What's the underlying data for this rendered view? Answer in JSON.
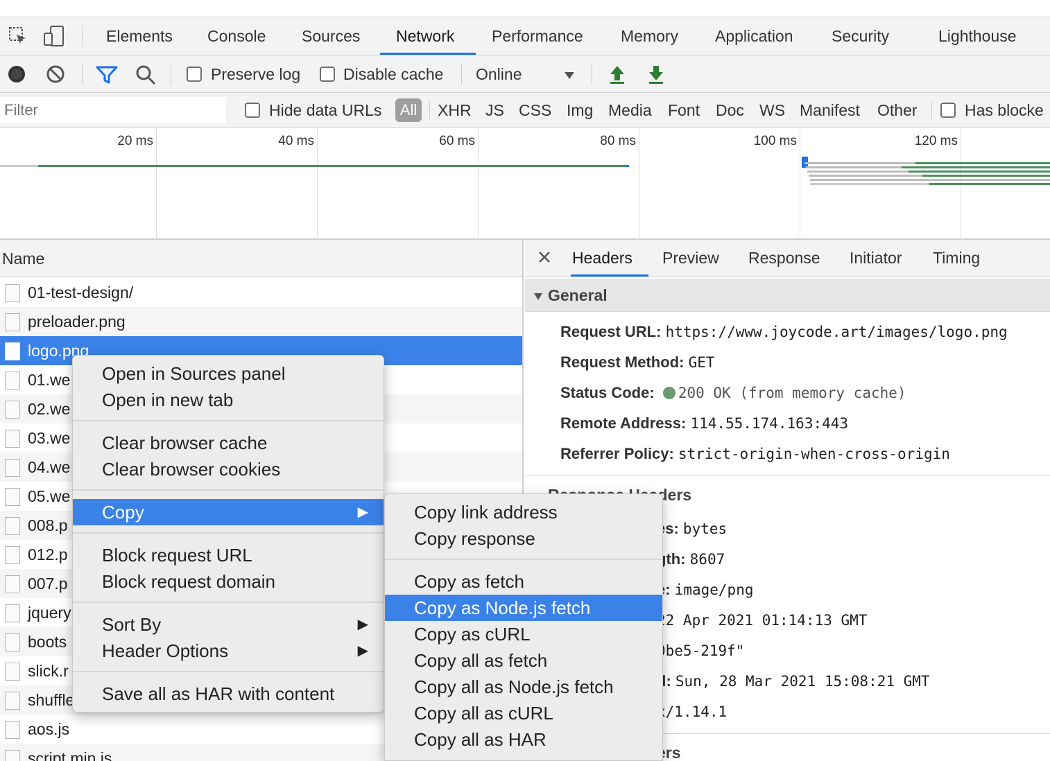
{
  "tabs": [
    {
      "label": "Elements"
    },
    {
      "label": "Console"
    },
    {
      "label": "Sources"
    },
    {
      "label": "Network",
      "active": true
    },
    {
      "label": "Performance"
    },
    {
      "label": "Memory"
    },
    {
      "label": "Application"
    },
    {
      "label": "Security"
    },
    {
      "label": "Lighthouse"
    }
  ],
  "toolbar": {
    "preserve_log": "Preserve log",
    "disable_cache": "Disable cache",
    "throttle": "Online",
    "icons": [
      "record-icon",
      "clear-icon",
      "filter-icon",
      "search-icon",
      "import-icon",
      "export-icon"
    ]
  },
  "filter": {
    "placeholder": "Filter",
    "hide_data_urls": "Hide data URLs",
    "types": [
      "All",
      "XHR",
      "JS",
      "CSS",
      "Img",
      "Media",
      "Font",
      "Doc",
      "WS",
      "Manifest",
      "Other"
    ],
    "has_blocked": "Has blocke"
  },
  "timeline": {
    "ticks": [
      "20 ms",
      "40 ms",
      "60 ms",
      "80 ms",
      "100 ms",
      "120 ms"
    ]
  },
  "list": {
    "header": "Name",
    "rows": [
      "01-test-design/",
      "preloader.png",
      "logo.png",
      "01.we",
      "02.we",
      "03.we",
      "04.we",
      "05.we",
      "008.p",
      "012.p",
      "007.p",
      "jquery",
      "boots",
      "slick.r",
      "shuffle",
      "aos.js",
      "script.min.js"
    ]
  },
  "detail": {
    "tabs": [
      "Headers",
      "Preview",
      "Response",
      "Initiator",
      "Timing"
    ],
    "general_title": "General",
    "general": [
      {
        "key": "Request URL:",
        "value": "https://www.joycode.art/images/logo.png"
      },
      {
        "key": "Request Method:",
        "value": "GET"
      },
      {
        "key": "Status Code:",
        "value": "200 OK (from memory cache)"
      },
      {
        "key": "Remote Address:",
        "value": "114.55.174.163:443"
      },
      {
        "key": "Referrer Policy:",
        "value": "strict-origin-when-cross-origin"
      }
    ],
    "response_title": "Response Headers",
    "response": [
      {
        "key": "es:",
        "value": "bytes"
      },
      {
        "key": "gth:",
        "value": "8607"
      },
      {
        "key": "e:",
        "value": "image/png"
      },
      {
        "key": "",
        "value": "22 Apr 2021 01:14:13 GMT"
      },
      {
        "key": "",
        "value": "0be5-219f\""
      },
      {
        "key": "d:",
        "value": "Sun, 28 Mar 2021 15:08:21 GMT"
      },
      {
        "key": "",
        "value": "x/1.14.1"
      }
    ],
    "request_title": "ers"
  },
  "context_menu": {
    "items": [
      "Open in Sources panel",
      "Open in new tab",
      "Clear browser cache",
      "Clear browser cookies",
      "Copy",
      "Block request URL",
      "Block request domain",
      "Sort By",
      "Header Options",
      "Save all as HAR with content"
    ]
  },
  "copy_submenu": {
    "items": [
      "Copy link address",
      "Copy response",
      "Copy as fetch",
      "Copy as Node.js fetch",
      "Copy as cURL",
      "Copy all as fetch",
      "Copy all as Node.js fetch",
      "Copy all as cURL",
      "Copy all as HAR"
    ]
  },
  "colors": {
    "accent": "#1a73e8",
    "selection": "#3b82e8",
    "status_ok": "#2e7d32"
  }
}
